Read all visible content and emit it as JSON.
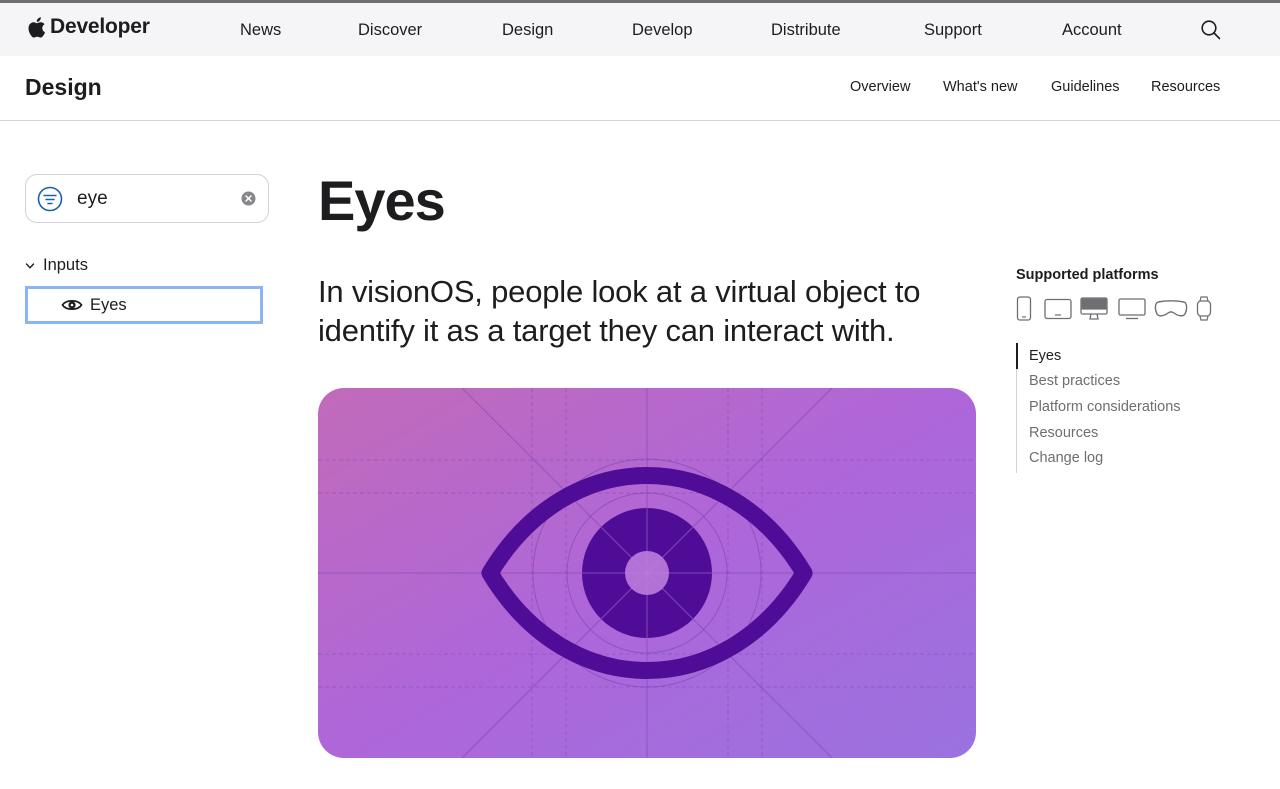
{
  "globalnav": {
    "brand": "Developer",
    "items": [
      "News",
      "Discover",
      "Design",
      "Develop",
      "Distribute",
      "Support",
      "Account"
    ],
    "search_icon": "search-icon"
  },
  "localnav": {
    "title": "Design",
    "items": [
      "Overview",
      "What's new",
      "Guidelines",
      "Resources"
    ]
  },
  "sidebar": {
    "filter_value": "eye",
    "group_label": "Inputs",
    "selected_item": "Eyes"
  },
  "main": {
    "title": "Eyes",
    "abstract_line1": "In visionOS, people look at a virtual object to",
    "abstract_line2": "identify it as a target they can interact with.",
    "hero_icon": "eye-icon"
  },
  "aside": {
    "platforms_title": "Supported platforms",
    "platforms": [
      "iphone-icon",
      "ipad-icon",
      "mac-icon",
      "tv-icon",
      "vision-pro-icon",
      "watch-icon"
    ],
    "toc": [
      "Eyes",
      "Best practices",
      "Platform considerations",
      "Resources",
      "Change log"
    ]
  },
  "colors": {
    "accent_focus": "#8ab4f8",
    "hero_gradient_start": "#c16bb9",
    "hero_gradient_end": "#9a6fe0",
    "eye_color": "#4f0c96"
  }
}
